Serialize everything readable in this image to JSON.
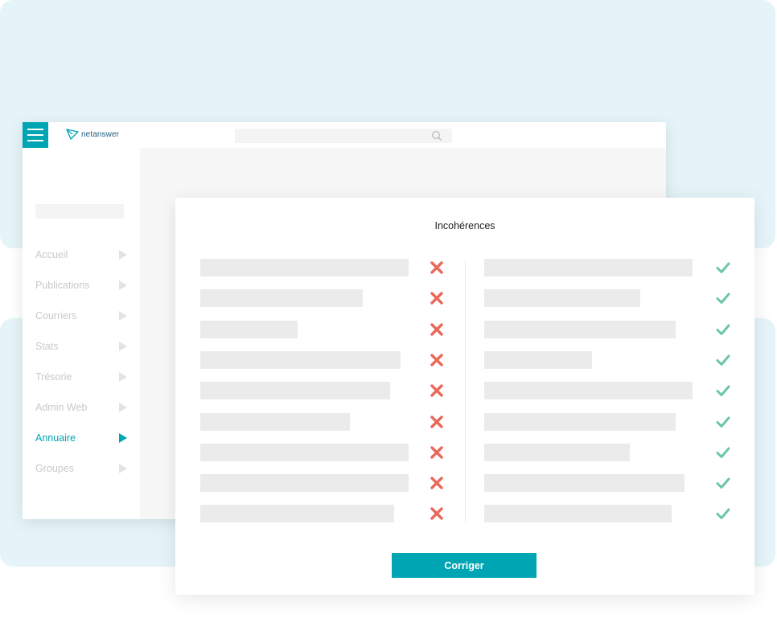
{
  "app": {
    "logo_text": "netanswer"
  },
  "nav": {
    "items": [
      {
        "label": "Accueil",
        "active": false
      },
      {
        "label": "Publications",
        "active": false
      },
      {
        "label": "Courriers",
        "active": false
      },
      {
        "label": "Stats",
        "active": false
      },
      {
        "label": "Trésorie",
        "active": false
      },
      {
        "label": "Admin Web",
        "active": false
      },
      {
        "label": "Annuaire",
        "active": true
      },
      {
        "label": "Groupes",
        "active": false
      }
    ]
  },
  "modal": {
    "title": "Incohérences",
    "button_label": "Corriger",
    "left_icon": "cross-icon",
    "right_icon": "check-icon",
    "left_rows": [
      0.99,
      0.77,
      0.46,
      0.95,
      0.9,
      0.71,
      0.99,
      0.99,
      0.92
    ],
    "right_rows": [
      0.99,
      0.74,
      0.91,
      0.51,
      0.99,
      0.91,
      0.69,
      0.95,
      0.89
    ]
  },
  "colors": {
    "accent": "#00a5b3",
    "cross": "#e8685a",
    "check": "#6dc7a2",
    "background": "#e4f4f8"
  }
}
